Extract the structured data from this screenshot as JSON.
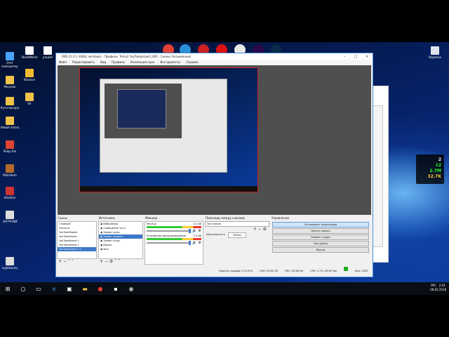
{
  "desktop": {
    "icons": [
      {
        "label": "Этот компьютер",
        "color": "#4aa3ff"
      },
      {
        "label": "StockMeme",
        "color": "#ffffff"
      },
      {
        "label": "project",
        "color": "#ffffff"
      },
      {
        "label": "Рисунок",
        "color": "#f0c24a"
      },
      {
        "label": "Binance",
        "color": "#f3ba2f"
      },
      {
        "label": "Куча мусора",
        "color": "#f0c24a"
      },
      {
        "label": "Sir",
        "color": "#f0c24a"
      },
      {
        "label": "Новая папка",
        "color": "#f0c24a"
      },
      {
        "label": "Paiky the",
        "color": "#d43"
      },
      {
        "label": "Minisform",
        "color": "#b46a2a"
      },
      {
        "label": "Intuition",
        "color": "#c33"
      },
      {
        "label": "ЗАГРУЗКИ",
        "color": "#ddd"
      },
      {
        "label": "курбазонц",
        "color": "#ddd"
      }
    ],
    "recycle_label": "Корзина"
  },
  "top_apps": [
    {
      "name": "chrome-icon",
      "color": "#e34133"
    },
    {
      "name": "maya-icon",
      "color": "#2a8fd6"
    },
    {
      "name": "record-icon",
      "color": "#c22"
    },
    {
      "name": "media-icon",
      "color": "#d11"
    },
    {
      "name": "notes-icon",
      "color": "#e8e8e8"
    },
    {
      "name": "premiere-icon",
      "color": "#2a0a4a"
    },
    {
      "name": "photoshop-icon",
      "color": "#0a2a4a"
    }
  ],
  "cpu_widget": {
    "v1": "2",
    "v2": "12",
    "v3": "2.7M",
    "v4": "32.7K"
  },
  "obs": {
    "title": "OBS 21.0.1 (64bit, windows) - Профиль: Tema2 YouTubeproject_X85 - Сцены: Безымянный",
    "menu": [
      "Файл",
      "Редактировать",
      "Вид",
      "Профиль",
      "Коллекция сцен",
      "Инструменты",
      "Справка"
    ],
    "scenes_title": "Сцены",
    "scenes": [
      "Главный",
      "Геолстр",
      "YouTubeMobile",
      "YouTubeHome",
      "YouTubeHome 1",
      "YouTubeHome 2",
      "YouTubeHome 2.1"
    ],
    "sources_title": "Источники",
    "sources": [
      "Вебкамера",
      "Сообщение чата",
      "Захват окна",
      "Захват экрана",
      "Захват игры",
      "Видео",
      "Фон"
    ],
    "mixer_title": "Микшер",
    "mixer": [
      {
        "name": "Mic/Aux",
        "db": "0.0 dB"
      },
      {
        "name": "Устройство воспроизведения",
        "db": "0.0 dB"
      }
    ],
    "transitions_title": "Переходы между сценами",
    "transition_value": "Затухание",
    "duration_label": "Длительность",
    "duration_value": "300ms",
    "controls_title": "Управление",
    "controls": [
      "Остановить трансляцию",
      "Начать запись",
      "Режим студии",
      "Настройки",
      "Выход"
    ],
    "status": {
      "dropped": "Пропуск кадров: 0 (0.0%)",
      "live": "LIVE: 00:02:32",
      "rec": "REC: 00:00:00",
      "cpu": "CPU: 3.7%, 60.00 fps",
      "bitrate": "kb/s: 2387"
    }
  },
  "taskbar": {
    "time": "2:41",
    "date": "08.02.2018",
    "lang": "РУС"
  }
}
